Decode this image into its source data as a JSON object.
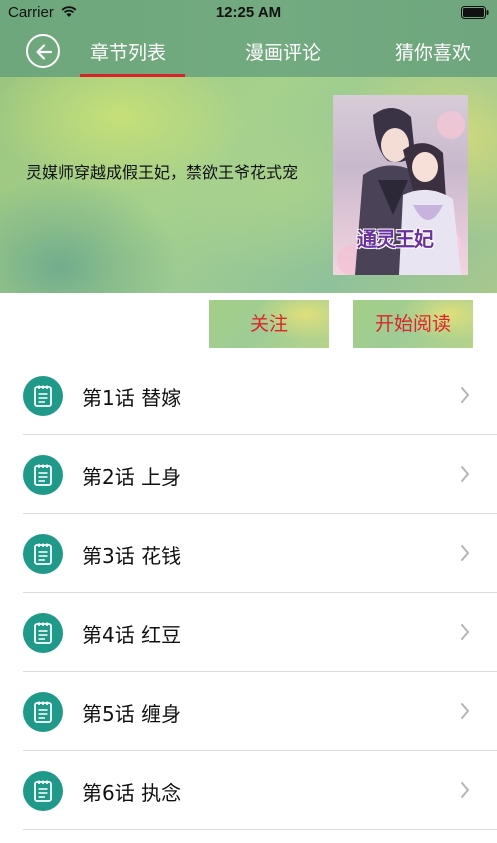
{
  "status": {
    "carrier": "Carrier",
    "time": "12:25 AM"
  },
  "nav": {
    "tabs": [
      {
        "label": "章节列表",
        "active": true
      },
      {
        "label": "漫画评论",
        "active": false
      },
      {
        "label": "猜你喜欢",
        "active": false
      }
    ]
  },
  "colors": {
    "nav_green": "#6ea77c",
    "accent_red": "#d8232a",
    "chapter_icon_teal": "#1f9a8a"
  },
  "comic": {
    "summary": "灵媒师穿越成假王妃，禁欲王爷花式宠",
    "cover_title": "通灵王妃"
  },
  "actions": {
    "follow_label": "关注",
    "read_label": "开始阅读"
  },
  "chapters": [
    {
      "title": "第1话 替嫁"
    },
    {
      "title": "第2话 上身"
    },
    {
      "title": "第3话 花钱"
    },
    {
      "title": "第4话 红豆"
    },
    {
      "title": "第5话 缠身"
    },
    {
      "title": "第6话 执念"
    }
  ]
}
